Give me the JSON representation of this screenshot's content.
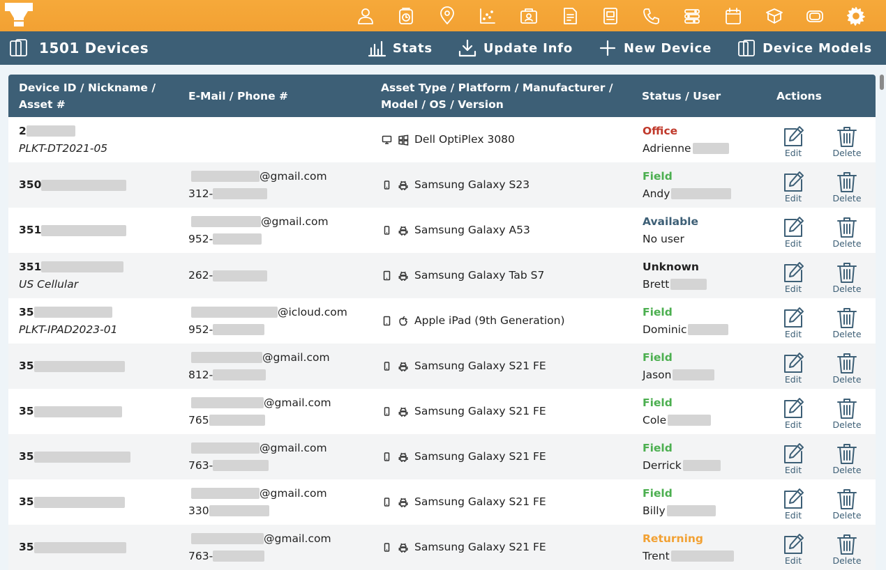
{
  "colors": {
    "brand_orange": "#f2a133",
    "header_blue": "#3d5f76",
    "status_office": "#c0392b",
    "status_field": "#4caf50",
    "status_available": "#3d5f76",
    "status_unknown": "#222222",
    "status_returning": "#f2a133"
  },
  "topbar": {
    "icons": [
      "user-icon",
      "clock-badge-icon",
      "location-icon",
      "scatter-grid-icon",
      "contact-card-icon",
      "document-icon",
      "drawer-icon",
      "phone-icon",
      "settings-sliders-icon",
      "calendar-icon",
      "cube-stack-icon",
      "sim-card-icon",
      "gear-icon"
    ]
  },
  "header": {
    "title": "1501 Devices",
    "stats_label": "Stats",
    "update_label": "Update Info",
    "new_label": "New Device",
    "models_label": "Device Models"
  },
  "table": {
    "headers": {
      "col1_line1": "Device ID / Nickname /",
      "col1_line2": "Asset #",
      "col2": "E-Mail / Phone #",
      "col3_line1": "Asset Type / Platform / Manufacturer /",
      "col3_line2": "Model / OS / Version",
      "col4": "Status / User",
      "col5": "Actions"
    },
    "edit_label": "Edit",
    "delete_label": "Delete",
    "rows": [
      {
        "id": "2",
        "nick": "PLKT-DT2021-05",
        "email": "",
        "email_blur": 0,
        "phone": "",
        "phone_blur": 0,
        "type": "desktop",
        "platform": "windows",
        "model": "Dell OptiPlex 3080",
        "status": "Office",
        "status_color": "#c0392b",
        "user": "Adrienne",
        "user_blur": 52,
        "id_blur": 70
      },
      {
        "id": "350",
        "nick": "",
        "email": "@gmail.com",
        "email_blur": 98,
        "phone": "312-",
        "phone_blur": 78,
        "type": "phone",
        "platform": "android",
        "model": "Samsung Galaxy S23",
        "status": "Field",
        "status_color": "#4caf50",
        "user": "Andy",
        "user_blur": 86,
        "id_blur": 122
      },
      {
        "id": "351",
        "nick": "",
        "email": "@gmail.com",
        "email_blur": 100,
        "phone": "952-",
        "phone_blur": 70,
        "type": "phone",
        "platform": "android",
        "model": "Samsung Galaxy A53",
        "status": "Available",
        "status_color": "#3d5f76",
        "user": "No user",
        "user_blur": 0,
        "id_blur": 122
      },
      {
        "id": "351",
        "nick": "US Cellular",
        "email": "",
        "email_blur": 0,
        "phone": "262-",
        "phone_blur": 78,
        "type": "tablet",
        "platform": "android",
        "model": "Samsung Galaxy Tab S7",
        "status": "Unknown",
        "status_color": "#222222",
        "user": "Brett",
        "user_blur": 52,
        "id_blur": 118
      },
      {
        "id": "35",
        "nick": "PLKT-IPAD2023-01",
        "email": "@icloud.com",
        "email_blur": 124,
        "phone": "952-",
        "phone_blur": 74,
        "type": "tablet",
        "platform": "apple",
        "model": "Apple iPad (9th Generation)",
        "status": "Field",
        "status_color": "#4caf50",
        "user": "Dominic",
        "user_blur": 58,
        "id_blur": 112
      },
      {
        "id": "35",
        "nick": "",
        "email": "@gmail.com",
        "email_blur": 102,
        "phone": "812-",
        "phone_blur": 76,
        "type": "phone",
        "platform": "android",
        "model": "Samsung Galaxy S21 FE",
        "status": "Field",
        "status_color": "#4caf50",
        "user": "Jason",
        "user_blur": 60,
        "id_blur": 130
      },
      {
        "id": "35",
        "nick": "",
        "email": "@gmail.com",
        "email_blur": 104,
        "phone": "765",
        "phone_blur": 80,
        "type": "phone",
        "platform": "android",
        "model": "Samsung Galaxy S21 FE",
        "status": "Field",
        "status_color": "#4caf50",
        "user": "Cole",
        "user_blur": 62,
        "id_blur": 126
      },
      {
        "id": "35",
        "nick": "",
        "email": "@gmail.com",
        "email_blur": 98,
        "phone": "763-",
        "phone_blur": 80,
        "type": "phone",
        "platform": "android",
        "model": "Samsung Galaxy S21 FE",
        "status": "Field",
        "status_color": "#4caf50",
        "user": "Derrick",
        "user_blur": 54,
        "id_blur": 138
      },
      {
        "id": "35",
        "nick": "",
        "email": "@gmail.com",
        "email_blur": 98,
        "phone": "330",
        "phone_blur": 86,
        "type": "phone",
        "platform": "android",
        "model": "Samsung Galaxy S21 FE",
        "status": "Field",
        "status_color": "#4caf50",
        "user": "Billy",
        "user_blur": 70,
        "id_blur": 130
      },
      {
        "id": "35",
        "nick": "",
        "email": "@gmail.com",
        "email_blur": 104,
        "phone": "763-",
        "phone_blur": 74,
        "type": "phone",
        "platform": "android",
        "model": "Samsung Galaxy S21 FE",
        "status": "Returning",
        "status_color": "#f2a133",
        "user": "Trent",
        "user_blur": 90,
        "id_blur": 132
      }
    ]
  }
}
